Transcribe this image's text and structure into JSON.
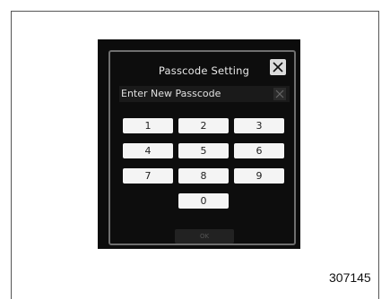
{
  "dialog": {
    "title": "Passcode Setting",
    "entry_label": "Enter New Passcode",
    "icons": {
      "close": "close-icon",
      "backspace": "backspace-icon"
    }
  },
  "keypad": {
    "keys": [
      "1",
      "2",
      "3",
      "4",
      "5",
      "6",
      "7",
      "8",
      "9",
      "0"
    ],
    "ok_label": "OK"
  },
  "figure_code": "307145"
}
